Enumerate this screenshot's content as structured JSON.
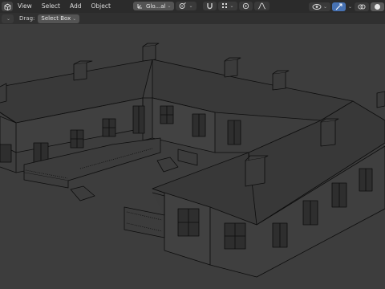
{
  "header": {
    "menus": [
      "View",
      "Select",
      "Add",
      "Object"
    ],
    "transform_orientation": "Glo...al",
    "snap_icon": "magnet-icon",
    "proportional_icon": "proportional-edit-icon"
  },
  "subheader": {
    "drag_label": "Drag:",
    "drag_value": "Select Box"
  },
  "icons": {
    "editor_type": "cube-icon",
    "pivot": "pivot-icon",
    "gizmo": "gizmo-icon",
    "overlay": "overlay-icon",
    "shading": "shading-solid-icon"
  },
  "colors": {
    "header_bg": "#2b2b2b",
    "viewport_bg": "#3d3d3d",
    "accent": "#4772b3"
  }
}
